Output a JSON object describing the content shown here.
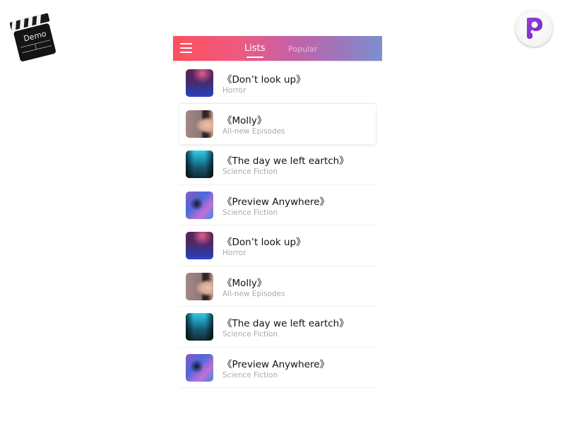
{
  "corner_logos": {
    "left": {
      "icon": "clapperboard-icon",
      "text": "Demo"
    },
    "right": {
      "icon": "p-app-logo-icon",
      "letter": "P"
    }
  },
  "header": {
    "menu_icon": "hamburger-menu-icon",
    "tabs": [
      {
        "label": "Lists",
        "active": true
      },
      {
        "label": "Popular",
        "active": false
      }
    ],
    "gradient": [
      "#fe4f5d",
      "#ef5a7e",
      "#c961a4",
      "#a174ba",
      "#7b90d0"
    ]
  },
  "list": {
    "items": [
      {
        "title": "《Don’t look up》",
        "subtitle": "Horror",
        "thumb": "horror"
      },
      {
        "title": "《Molly》",
        "subtitle": "All-new Episodes",
        "thumb": "molly",
        "active": true
      },
      {
        "title": "《The day we left eartch》",
        "subtitle": "Science Fiction",
        "thumb": "earth"
      },
      {
        "title": "《Preview Anywhere》",
        "subtitle": "Science Fiction",
        "thumb": "preview"
      },
      {
        "title": "《Don’t look up》",
        "subtitle": "Horror",
        "thumb": "horror"
      },
      {
        "title": "《Molly》",
        "subtitle": "All-new Episodes",
        "thumb": "molly"
      },
      {
        "title": "《The day we left eartch》",
        "subtitle": "Science Fiction",
        "thumb": "earth"
      },
      {
        "title": "《Preview Anywhere》",
        "subtitle": "Science Fiction",
        "thumb": "preview"
      }
    ]
  }
}
